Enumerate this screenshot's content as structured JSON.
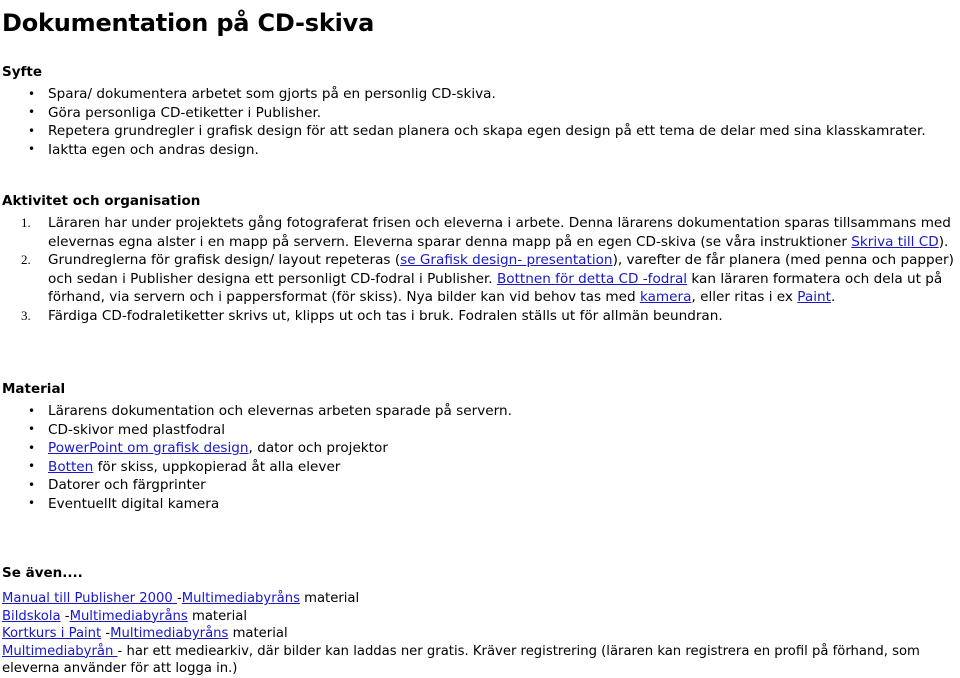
{
  "document": {
    "title": "Dokumentation på CD-skiva",
    "link_color": "#1818c8",
    "text_color": "#000000",
    "background_color": "#ffffff"
  },
  "sections": {
    "syfte": {
      "heading": "Syfte",
      "bullets": [
        "Spara/ dokumentera arbetet som gjorts på en personlig CD-skiva.",
        "Göra personliga CD-etiketter i Publisher.",
        "Repetera grundregler i grafisk design för att sedan planera och skapa egen design på ett tema de delar med sina klasskamrater.",
        "Iaktta egen och andras design."
      ]
    },
    "aktivitet": {
      "heading": "Aktivitet och organisation",
      "item1": {
        "part1": "Läraren har under projektets gång fotograferat frisen och eleverna i arbete. Denna lärarens dokumentation sparas tillsammans med elevernas egna alster i en mapp på servern. Eleverna sparar denna mapp på en egen CD-skiva (se våra instruktioner ",
        "link1": "Skriva till CD",
        "part2": ")."
      },
      "item2": {
        "part1": "Grundreglerna för grafisk design/ layout repeteras (",
        "link1": "se Grafisk design- presentation",
        "part2": "), varefter de får planera (med penna och papper) och sedan i Publisher designa ett personligt CD-fodral i Publisher. ",
        "link2": "Bottnen för detta CD -fodral",
        "part3": " kan läraren formatera och dela ut på förhand, via servern och i pappersformat (för skiss). Nya bilder kan vid behov tas med ",
        "link3": "kamera",
        "part4": ", eller ritas i ex ",
        "link4": "Paint",
        "part5": "."
      },
      "item3": {
        "text": "Färdiga CD-fodraletiketter skrivs ut, klipps ut och tas i bruk. Fodralen ställs ut för allmän beundran."
      }
    },
    "material": {
      "heading": "Material",
      "bullets": [
        {
          "text": "Lärarens dokumentation och elevernas arbeten sparade på servern.",
          "link": ""
        },
        {
          "text": "CD-skivor med plastfodral",
          "link": ""
        },
        {
          "text": ", dator och projektor",
          "link": "PowerPoint om grafisk design"
        },
        {
          "text": " för skiss, uppkopierad åt alla elever",
          "link": "Botten"
        },
        {
          "text": "Datorer och färgprinter",
          "link": ""
        },
        {
          "text": "Eventuellt digital kamera",
          "link": ""
        }
      ]
    },
    "se_aven": {
      "heading": "Se även....",
      "rows": [
        {
          "link1": "Manual till Publisher 2000 ",
          "mid": " -",
          "link2": "Multimediabyråns",
          "tail": " material"
        },
        {
          "link1": "Bildskola",
          "mid": " -",
          "link2": "Multimediabyråns",
          "tail": " material"
        },
        {
          "link1": "Kortkurs i Paint",
          "mid": " -",
          "link2": "Multimediabyråns",
          "tail": " material"
        }
      ],
      "last_row": {
        "link": "Multimediabyrån ",
        "text": "- har ett mediearkiv, där bilder kan laddas ner gratis. Kräver registrering (läraren kan registrera en profil på förhand, som eleverna använder för att logga in.)"
      }
    }
  }
}
